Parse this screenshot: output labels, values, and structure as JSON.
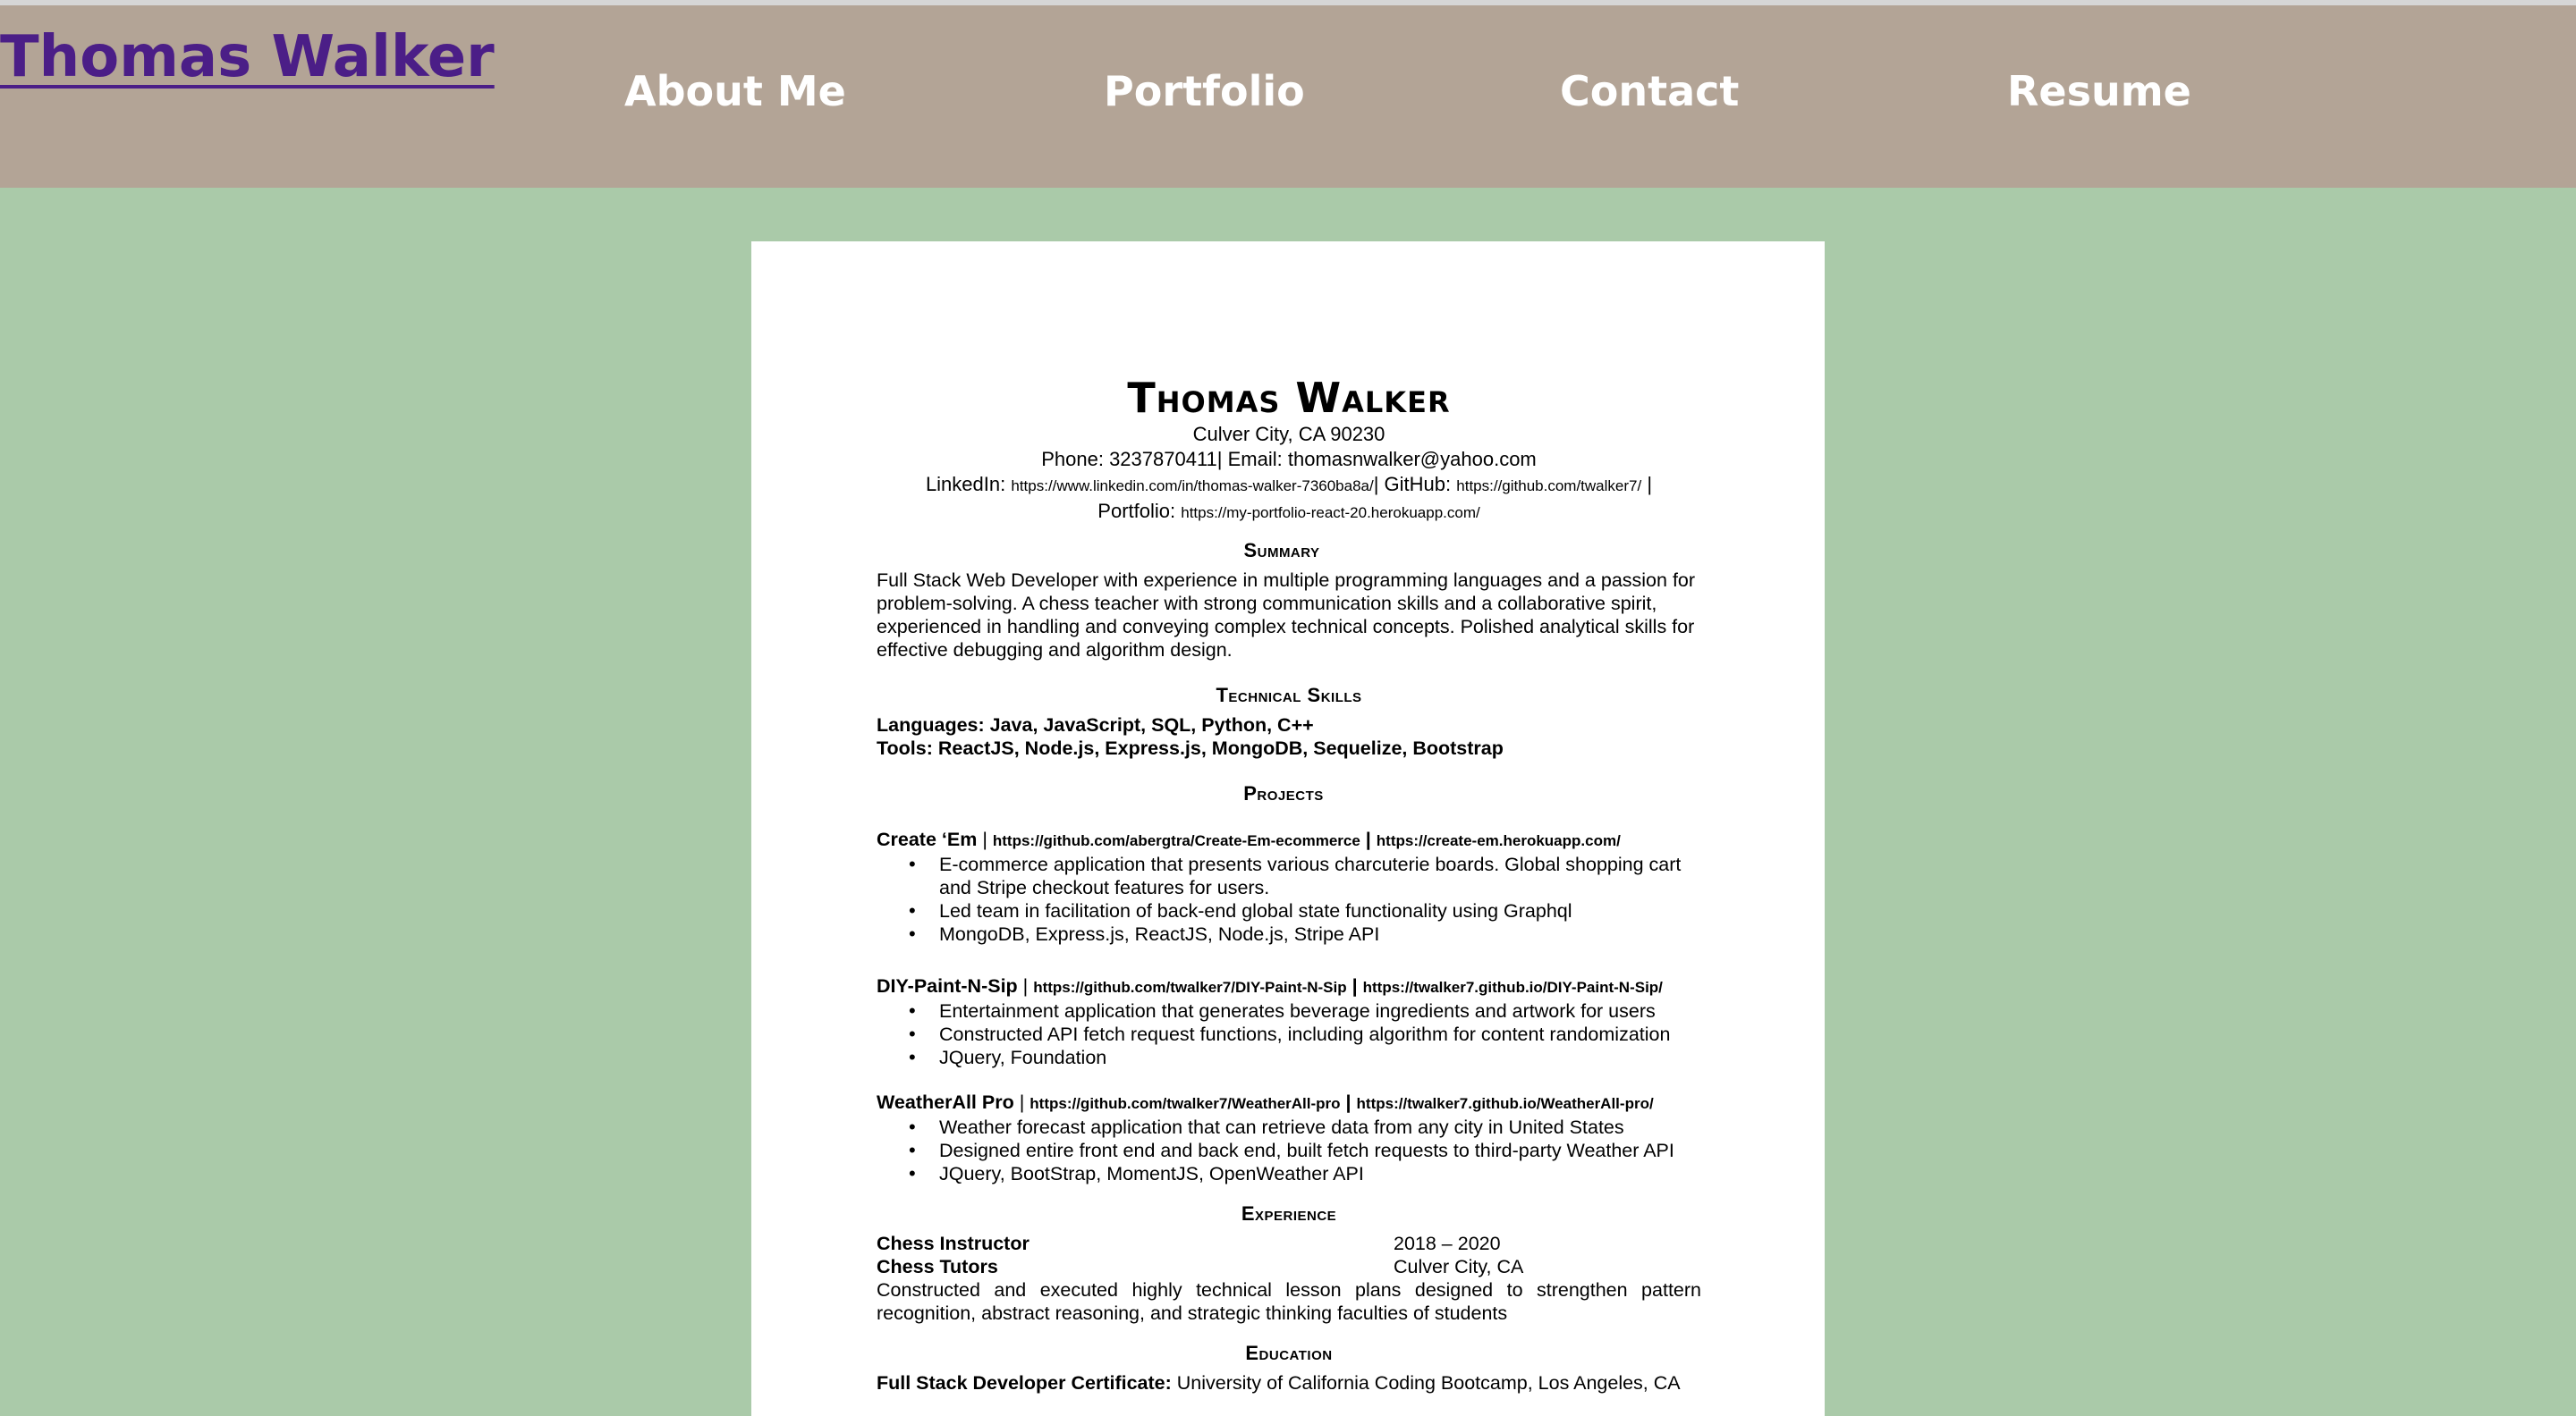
{
  "header": {
    "brand": "Thomas Walker",
    "nav": [
      "About Me",
      "Portfolio",
      "Contact",
      "Resume"
    ]
  },
  "resume": {
    "name": "Thomas Walker",
    "address": "Culver City, CA 90230",
    "phone_email": "Phone: 3237870411| Email: thomasnwalker@yahoo.com",
    "linkedin_label": "LinkedIn:",
    "linkedin_url": "https://www.linkedin.com/in/thomas-walker-7360ba8a/",
    "github_label": "| GitHub:",
    "github_url": "https://github.com/twalker7/",
    "sep_end": "|",
    "portfolio_label": "Portfolio:",
    "portfolio_url": "https://my-portfolio-react-20.herokuapp.com/",
    "summary_heading": "Summary",
    "summary": "Full Stack Web Developer with experience in multiple programming languages and a passion for problem-solving. A chess teacher with strong communication skills and a collaborative spirit, experienced in handling and conveying complex technical concepts. Polished analytical skills for effective debugging and algorithm design.",
    "skills_heading": "Technical Skills",
    "languages": "Languages: Java, JavaScript, SQL, Python, C++",
    "tools": "Tools: ReactJS, Node.js, Express.js, MongoDB, Sequelize, Bootstrap",
    "projects_heading": "Projects",
    "projects": [
      {
        "name": "Create ‘Em",
        "sep1": " | ",
        "repo": "https://github.com/abergtra/Create-Em-ecommerce",
        "sep2": " | ",
        "site": "https://create-em.herokuapp.com/",
        "bullets": [
          "E-commerce application that presents various charcuterie boards. Global shopping cart and Stripe checkout features for users.",
          "Led team in facilitation of back-end global state functionality using Graphql",
          "MongoDB, Express.js, ReactJS, Node.js, Stripe API"
        ]
      },
      {
        "name": "DIY-Paint-N-Sip",
        "sep1": " | ",
        "repo": "https://github.com/twalker7/DIY-Paint-N-Sip",
        "sep2": " | ",
        "site": "https://twalker7.github.io/DIY-Paint-N-Sip/",
        "bullets": [
          "Entertainment application that generates beverage ingredients and artwork for users",
          "Constructed API fetch request functions, including algorithm for content randomization",
          "JQuery, Foundation"
        ]
      },
      {
        "name": "WeatherAll Pro",
        "sep1": " | ",
        "repo": "https://github.com/twalker7/WeatherAll-pro",
        "sep2": " | ",
        "site": "https://twalker7.github.io/WeatherAll-pro/",
        "bullets": [
          "Weather forecast application that can retrieve data from any city in United States",
          "Designed entire front end and back end, built fetch requests to third-party Weather API",
          "JQuery, BootStrap, MomentJS, OpenWeather API"
        ]
      }
    ],
    "experience_heading": "Experience",
    "experience": {
      "title": "Chess Instructor",
      "dates": "2018 – 2020",
      "company": "Chess Tutors",
      "location": "Culver City, CA",
      "description": "Constructed and executed highly technical lesson plans designed to strengthen pattern recognition, abstract reasoning, and strategic thinking faculties of students"
    },
    "education_heading": "Education",
    "education": {
      "label": "Full Stack Developer Certificate:",
      "detail": " University of California Coding Bootcamp, Los Angeles, CA"
    }
  }
}
